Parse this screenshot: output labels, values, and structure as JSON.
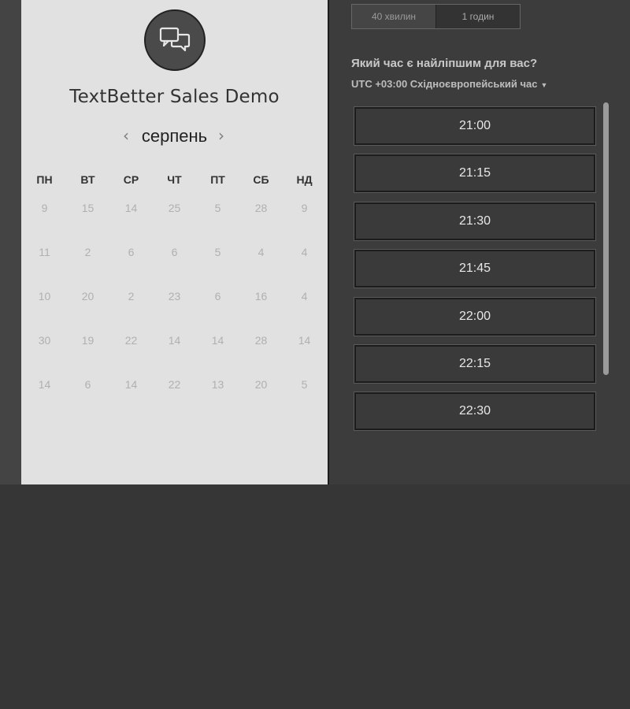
{
  "event": {
    "title": "TextBetter Sales Demo",
    "avatar_icon": "chat-bubbles-icon"
  },
  "calendar": {
    "month": "серпень",
    "prev_icon": "chevron-left-icon",
    "next_icon": "chevron-right-icon",
    "weekdays": [
      "ПН",
      "ВТ",
      "СР",
      "ЧТ",
      "ПТ",
      "СБ",
      "НД"
    ],
    "weeks": [
      [
        "9",
        "15",
        "14",
        "25",
        "5",
        "28",
        "9"
      ],
      [
        "11",
        "2",
        "6",
        "6",
        "5",
        "4",
        "4"
      ],
      [
        "10",
        "20",
        "2",
        "23",
        "6",
        "16",
        "4"
      ],
      [
        "30",
        "19",
        "22",
        "14",
        "14",
        "28",
        "14"
      ],
      [
        "14",
        "6",
        "14",
        "22",
        "13",
        "20",
        "5"
      ]
    ]
  },
  "duration": {
    "options": [
      "40 хвилин",
      "1 годин"
    ],
    "selected_index": 1
  },
  "scheduler": {
    "question": "Який час є найліпшим для вас?",
    "timezone": "UTC +03:00 Східноєвропейський час",
    "timezone_icon": "caret-down-icon",
    "slots": [
      "21:00",
      "21:15",
      "21:30",
      "21:45",
      "22:00",
      "22:15",
      "22:30"
    ]
  }
}
